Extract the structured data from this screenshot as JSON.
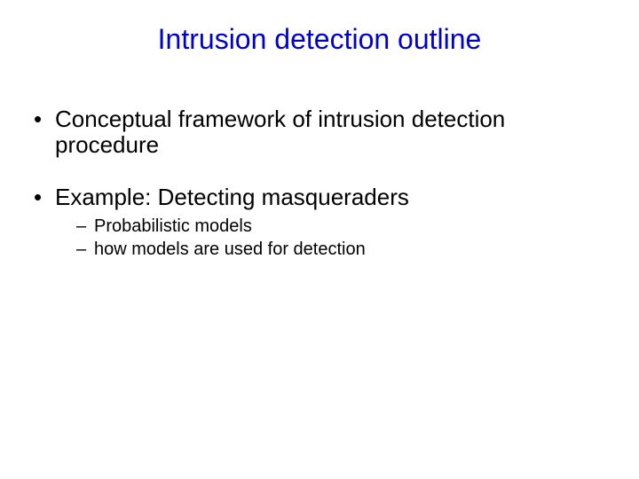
{
  "title": "Intrusion detection outline",
  "bullets": [
    {
      "text": "Conceptual framework of intrusion detection procedure",
      "sub": []
    },
    {
      "text": "Example: Detecting masqueraders",
      "sub": [
        "Probabilistic models",
        "how models are used for detection"
      ]
    }
  ]
}
